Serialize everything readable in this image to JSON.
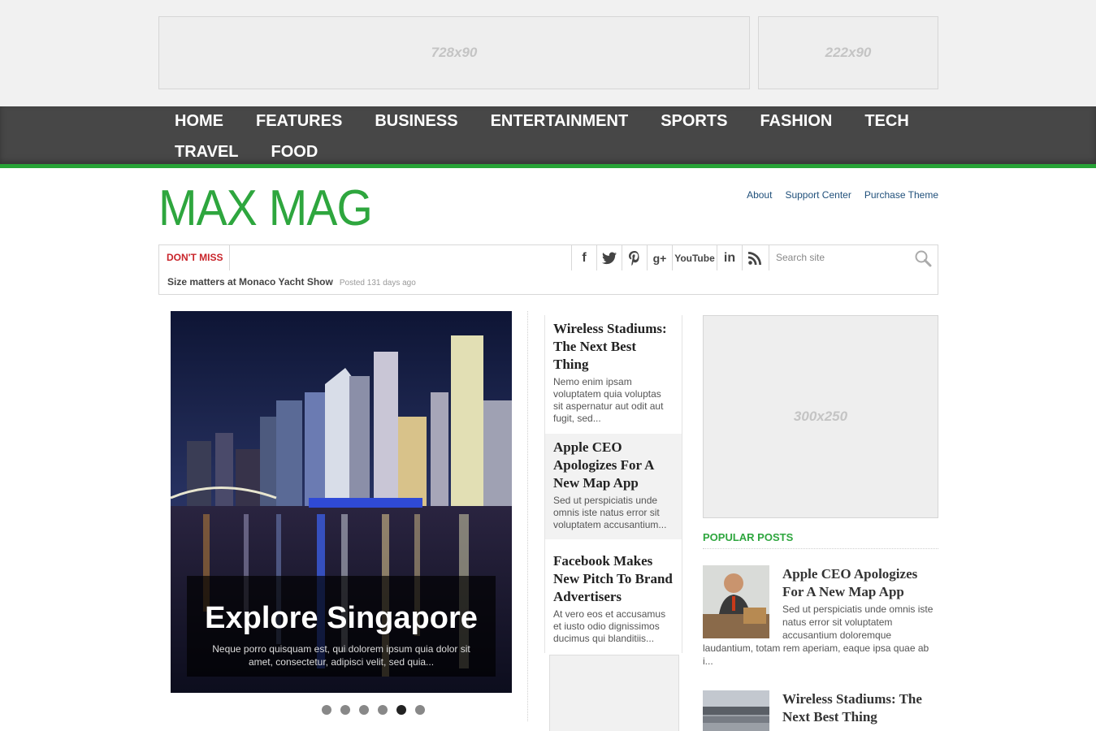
{
  "ads": {
    "leaderboard": "728x90",
    "small": "222x90",
    "sidebar": "300x250"
  },
  "nav": {
    "items": [
      "HOME",
      "FEATURES",
      "BUSINESS",
      "ENTERTAINMENT",
      "SPORTS",
      "FASHION",
      "TECH",
      "TRAVEL",
      "FOOD"
    ]
  },
  "header": {
    "logo": "MAX MAG",
    "links": [
      "About",
      "Support Center",
      "Purchase Theme"
    ]
  },
  "dont_miss": {
    "label": "DON'T MISS",
    "headline": "Size matters at Monaco Yacht Show",
    "posted": "Posted 131 days ago"
  },
  "social": {
    "icons": [
      "facebook-icon",
      "twitter-icon",
      "pinterest-icon",
      "google-plus-icon",
      "youtube-icon",
      "linkedin-icon",
      "rss-icon"
    ],
    "facebook": "f",
    "google": "g+",
    "youtube": "YouTube",
    "linkedin": "in"
  },
  "search": {
    "placeholder": "Search site"
  },
  "slider": {
    "title": "Explore Singapore",
    "excerpt": "Neque porro quisquam est, qui dolorem ipsum quia dolor sit amet, consectetur, adipisci velit, sed quia...",
    "slide_count": 6,
    "active_index": 4
  },
  "middle": [
    {
      "title": "Wireless Stadiums: The Next Best Thing",
      "excerpt": "Nemo enim ipsam voluptatem quia voluptas sit aspernatur aut odit aut fugit, sed..."
    },
    {
      "title": "Apple CEO Apologizes For A New Map App",
      "excerpt": "Sed ut perspiciatis unde omnis iste natus error sit voluptatem accusantium..."
    },
    {
      "title": "Facebook Makes New Pitch To Brand Advertisers",
      "excerpt": "At vero eos et accusamus et iusto odio dignissimos ducimus qui blanditiis..."
    }
  ],
  "popular": {
    "title": "POPULAR POSTS",
    "items": [
      {
        "title": "Apple CEO Apologizes For A New Map App",
        "excerpt": "Sed ut perspiciatis unde omnis iste natus error sit voluptatem accusantium doloremque laudantium, totam rem aperiam, eaque ipsa quae ab i..."
      },
      {
        "title": "Wireless Stadiums: The Next Best Thing",
        "excerpt": ""
      }
    ]
  },
  "colors": {
    "accent": "#27a336",
    "nav_bg": "#474747",
    "dont_miss": "#c9252b",
    "link": "#1f4f7a"
  }
}
